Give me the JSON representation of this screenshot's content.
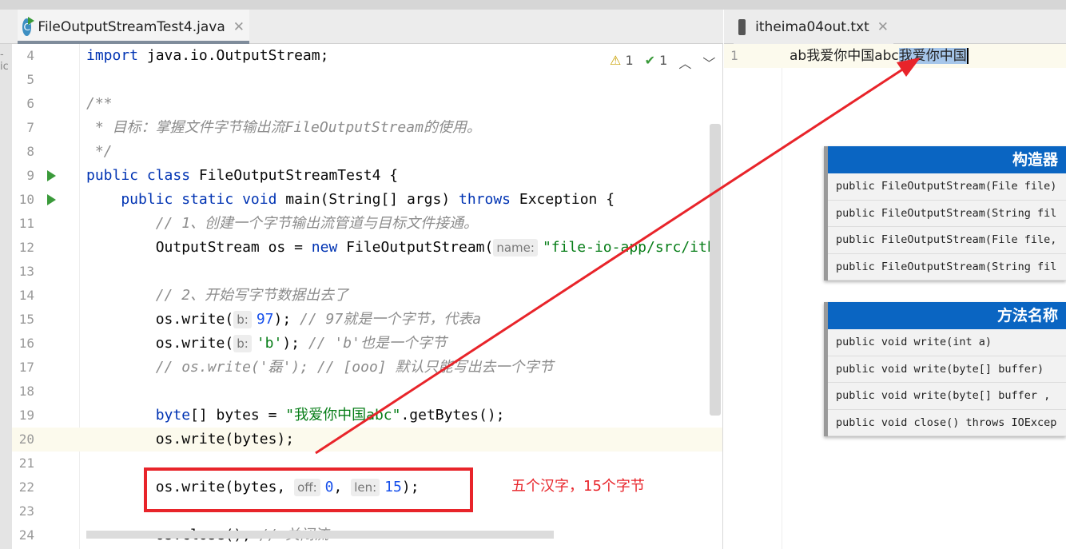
{
  "left_tab": {
    "title": "FileOutputStreamTest4.java",
    "icon": "java-class-icon",
    "icon_letter": "C"
  },
  "right_tab": {
    "title": "itheima04out.txt",
    "icon": "text-file-icon"
  },
  "left_edge_text": "-ic",
  "inspections": {
    "warnings": "1",
    "ok": "1"
  },
  "code_lines": [
    {
      "n": "4",
      "segs": [
        {
          "k": "kw",
          "t": "import "
        },
        {
          "k": "pl",
          "t": "java.io.OutputStream;"
        }
      ]
    },
    {
      "n": "5",
      "segs": []
    },
    {
      "n": "6",
      "segs": [
        {
          "k": "cm",
          "t": "/**"
        }
      ]
    },
    {
      "n": "7",
      "segs": [
        {
          "k": "cm",
          "t": " * 目标：掌握文件字节输出流FileOutputStream的使用。"
        }
      ]
    },
    {
      "n": "8",
      "segs": [
        {
          "k": "cm",
          "t": " */"
        }
      ]
    },
    {
      "n": "9",
      "run": true,
      "segs": [
        {
          "k": "kw",
          "t": "public class "
        },
        {
          "k": "pl",
          "t": "FileOutputStreamTest4 {"
        }
      ]
    },
    {
      "n": "10",
      "run": true,
      "segs": [
        {
          "k": "kw",
          "t": "    public static void "
        },
        {
          "k": "pl",
          "t": "main(String[] args) "
        },
        {
          "k": "kw",
          "t": "throws "
        },
        {
          "k": "pl",
          "t": "Exception {"
        }
      ]
    },
    {
      "n": "11",
      "segs": [
        {
          "k": "cm",
          "t": "        // 1、创建一个字节输出流管道与目标文件接通。"
        }
      ]
    },
    {
      "n": "12",
      "segs": [
        {
          "k": "pl",
          "t": "        OutputStream os = "
        },
        {
          "k": "kw",
          "t": "new "
        },
        {
          "k": "pl",
          "t": "FileOutputStream("
        },
        {
          "k": "hint",
          "t": "name:"
        },
        {
          "k": "str",
          "t": "\"file-io-app/src/ith"
        }
      ]
    },
    {
      "n": "13",
      "segs": []
    },
    {
      "n": "14",
      "segs": [
        {
          "k": "cm",
          "t": "        // 2、开始写字节数据出去了"
        }
      ]
    },
    {
      "n": "15",
      "segs": [
        {
          "k": "pl",
          "t": "        os.write("
        },
        {
          "k": "hint",
          "t": "b:"
        },
        {
          "k": "num",
          "t": "97"
        },
        {
          "k": "pl",
          "t": "); "
        },
        {
          "k": "cm",
          "t": "// 97就是一个字节，代表a"
        }
      ]
    },
    {
      "n": "16",
      "segs": [
        {
          "k": "pl",
          "t": "        os.write("
        },
        {
          "k": "hint",
          "t": "b:"
        },
        {
          "k": "str",
          "t": "'b'"
        },
        {
          "k": "pl",
          "t": "); "
        },
        {
          "k": "cm",
          "t": "// 'b'也是一个字节"
        }
      ]
    },
    {
      "n": "17",
      "segs": [
        {
          "k": "cm",
          "t": "        // os.write('磊'); // [ooo] 默认只能写出去一个字节"
        }
      ]
    },
    {
      "n": "18",
      "segs": []
    },
    {
      "n": "19",
      "segs": [
        {
          "k": "kw",
          "t": "        byte"
        },
        {
          "k": "pl",
          "t": "[] bytes = "
        },
        {
          "k": "str",
          "t": "\"我爱你中国abc\""
        },
        {
          "k": "pl",
          "t": ".getBytes();"
        }
      ]
    },
    {
      "n": "20",
      "current": true,
      "segs": [
        {
          "k": "pl",
          "t": "        os.write(bytes);"
        }
      ]
    },
    {
      "n": "21",
      "segs": []
    },
    {
      "n": "22",
      "segs": [
        {
          "k": "pl",
          "t": "        os.write(bytes, "
        },
        {
          "k": "hint",
          "t": "off:"
        },
        {
          "k": "num",
          "t": "0"
        },
        {
          "k": "pl",
          "t": ", "
        },
        {
          "k": "hint",
          "t": "len:"
        },
        {
          "k": "num",
          "t": "15"
        },
        {
          "k": "pl",
          "t": ");"
        }
      ]
    },
    {
      "n": "23",
      "segs": []
    },
    {
      "n": "24",
      "segs": [
        {
          "k": "pl",
          "t": "        os.close(); "
        },
        {
          "k": "cm",
          "t": "// 关闭流"
        }
      ]
    }
  ],
  "output_file": {
    "line_number": "1",
    "text": "ab我爱你中国abc",
    "selected_text": "我爱你中国"
  },
  "constructor_card": {
    "title": "构造器",
    "rows": [
      "public FileOutputStream(File file)",
      "public FileOutputStream(String fil",
      "public FileOutputStream(File file,",
      "public FileOutputStream(String fil"
    ]
  },
  "method_card": {
    "title": "方法名称",
    "rows": [
      "public void write(int a)",
      "public void write(byte[] buffer)",
      "public void write(byte[] buffer ,",
      " public void close() throws IOExcep"
    ]
  },
  "annotation": {
    "text": "五个汉字，15个字节",
    "color": "#e8242a"
  }
}
